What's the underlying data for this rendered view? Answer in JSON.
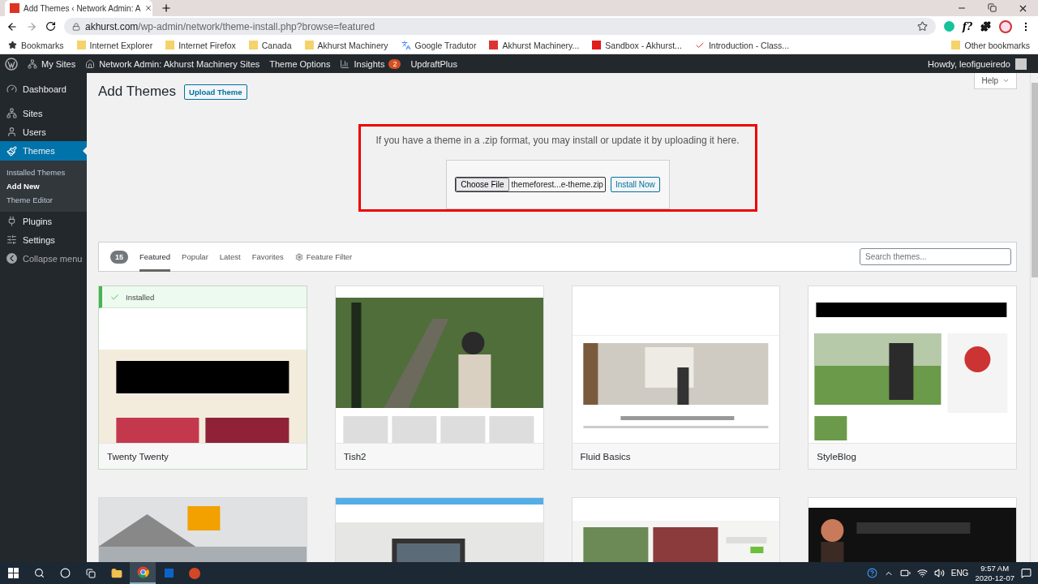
{
  "browser": {
    "tab_title": "Add Themes ‹ Network Admin: A",
    "url_host": "akhurst.com",
    "url_path": "/wp-admin/network/theme-install.php?browse=featured",
    "extension_label": "f?",
    "bookmarks": [
      {
        "label": "Bookmarks",
        "kind": "star"
      },
      {
        "label": "Internet Explorer",
        "kind": "folder"
      },
      {
        "label": "Internet Firefox",
        "kind": "folder"
      },
      {
        "label": "Canada",
        "kind": "folder"
      },
      {
        "label": "Akhurst Machinery",
        "kind": "folder"
      },
      {
        "label": "Google Tradutor",
        "kind": "translate"
      },
      {
        "label": "Akhurst Machinery...",
        "kind": "site"
      },
      {
        "label": "Sandbox - Akhurst...",
        "kind": "sandbox"
      },
      {
        "label": "Introduction - Class...",
        "kind": "check"
      }
    ],
    "other_bookmarks": "Other bookmarks"
  },
  "admin_bar": {
    "items": [
      {
        "label": "My Sites",
        "kind": "sites"
      },
      {
        "label": "Network Admin: Akhurst Machinery Sites",
        "kind": "home"
      },
      {
        "label": "Theme Options",
        "kind": "plain"
      },
      {
        "label": "Insights",
        "kind": "chart",
        "badge": "2"
      },
      {
        "label": "UpdraftPlus",
        "kind": "plain"
      }
    ],
    "howdy": "Howdy, leofigueiredo"
  },
  "sidebar": {
    "items": [
      {
        "label": "Dashboard",
        "kind": "dashboard",
        "selected": false
      },
      {
        "label": "Sites",
        "kind": "sites",
        "selected": false
      },
      {
        "label": "Users",
        "kind": "users",
        "selected": false
      },
      {
        "label": "Themes",
        "kind": "themes",
        "selected": true,
        "children": [
          {
            "label": "Installed Themes",
            "selected": false
          },
          {
            "label": "Add New",
            "selected": true
          },
          {
            "label": "Theme Editor",
            "selected": false
          }
        ]
      },
      {
        "label": "Plugins",
        "kind": "plugins",
        "selected": false
      },
      {
        "label": "Settings",
        "kind": "settings",
        "selected": false
      }
    ],
    "collapse": "Collapse menu"
  },
  "page": {
    "title": "Add Themes",
    "upload_button": "Upload Theme",
    "help_button": "Help"
  },
  "upload": {
    "text": "If you have a theme in a .zip format, you may install or update it by uploading it here.",
    "choose_file": "Choose File",
    "file_name": "themeforest...e-theme.zip",
    "install_button": "Install Now"
  },
  "filter": {
    "count": "15",
    "tabs": [
      {
        "label": "Featured",
        "selected": true
      },
      {
        "label": "Popular",
        "selected": false
      },
      {
        "label": "Latest",
        "selected": false
      },
      {
        "label": "Favorites",
        "selected": false
      }
    ],
    "feature_filter": "Feature Filter",
    "search_placeholder": "Search themes..."
  },
  "installed_label": "Installed",
  "themes": [
    {
      "name": "Twenty Twenty",
      "installed": true
    },
    {
      "name": "Tish2",
      "installed": false
    },
    {
      "name": "Fluid Basics",
      "installed": false
    },
    {
      "name": "StyleBlog",
      "installed": false
    }
  ],
  "taskbar": {
    "language": "ENG",
    "time": "9:57 AM",
    "date": "2020-12-07"
  }
}
